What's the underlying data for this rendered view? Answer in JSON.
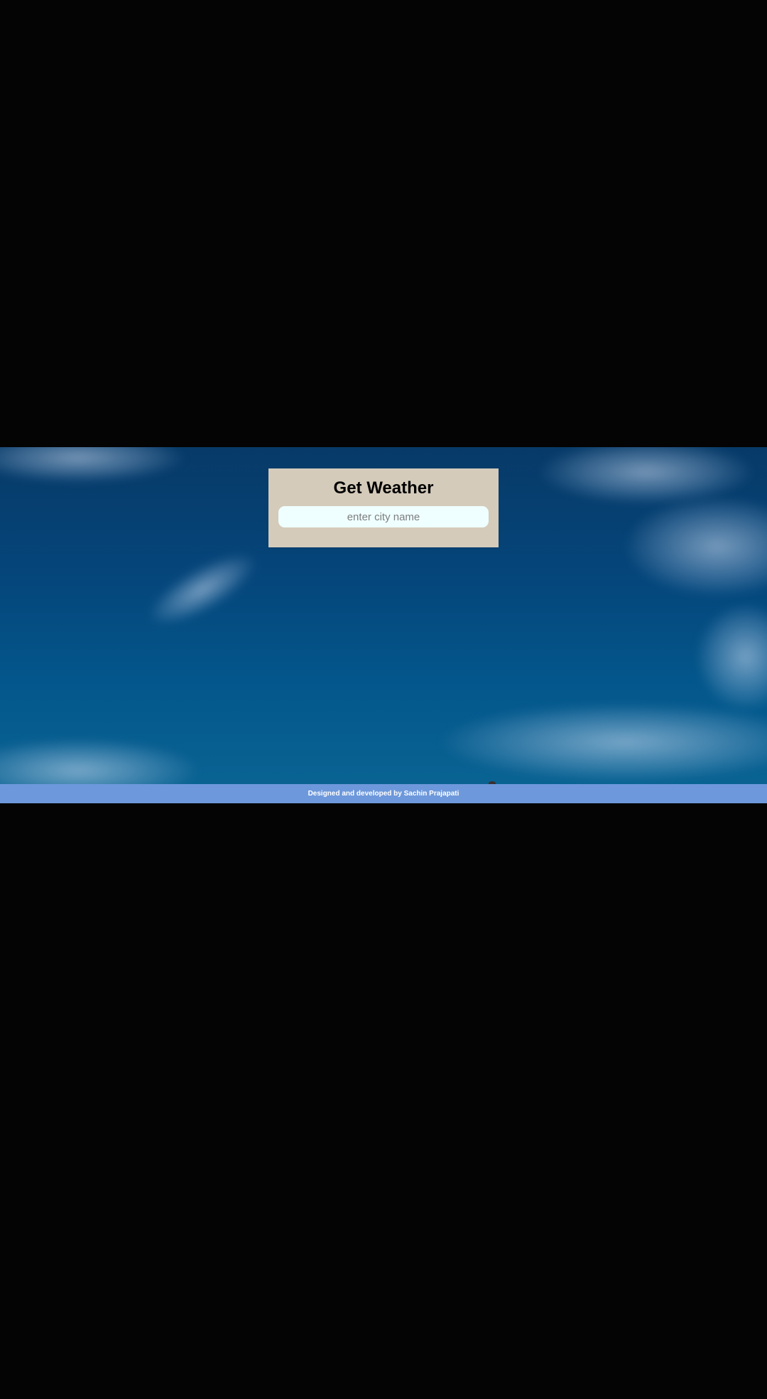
{
  "app": {
    "title": "Get Weather"
  },
  "search": {
    "placeholder": "enter city name",
    "value": ""
  },
  "footer": {
    "credit": "Designed and developed by Sachin Prajapati"
  },
  "colors": {
    "page_background": "#040404",
    "card_background": "#d5cbbb",
    "input_background": "#efffff",
    "footer_background": "#6d98db",
    "footer_text": "#ffffff"
  }
}
